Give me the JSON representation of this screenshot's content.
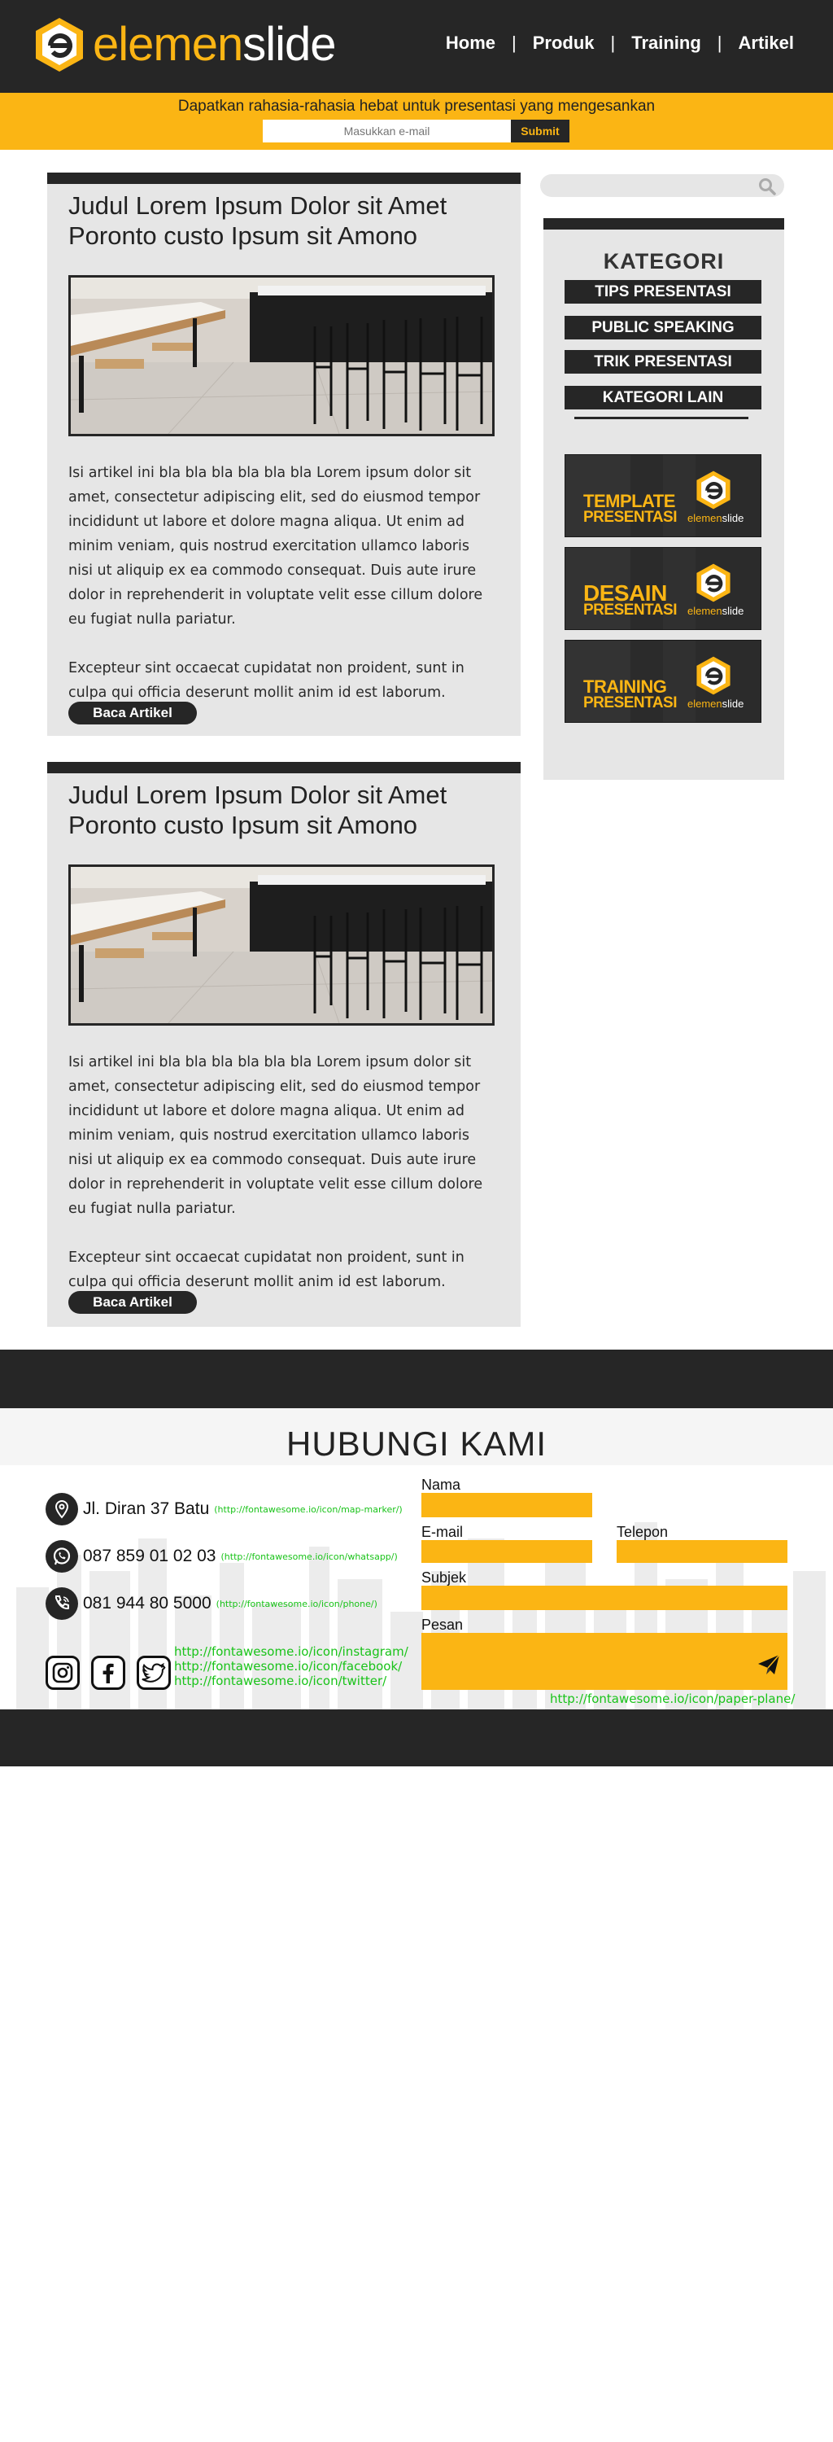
{
  "header": {
    "logo": {
      "part1": "elemen",
      "part2": "slide"
    },
    "nav": [
      "Home",
      "Produk",
      "Training",
      "Artikel"
    ],
    "nav_separator": "|"
  },
  "newsletter": {
    "tagline": "Dapatkan rahasia-rahasia hebat untuk presentasi yang mengesankan",
    "email_placeholder": "Masukkan e-mail",
    "submit_label": "Submit"
  },
  "articles": [
    {
      "title": "Judul Lorem Ipsum Dolor sit Amet Poronto custo Ipsum sit Amono",
      "paragraph1": "Isi artikel ini bla bla bla bla bla bla Lorem ipsum dolor sit amet, consectetur adipiscing elit, sed do eiusmod tempor incididunt ut labore et dolore magna aliqua. Ut enim ad minim veniam, quis nostrud exercitation ullamco laboris nisi ut aliquip ex ea commodo consequat. Duis aute irure dolor in reprehenderit in voluptate velit esse cillum dolore eu fugiat nulla pariatur.",
      "paragraph2": "Excepteur sint occaecat cupidatat non proident, sunt in culpa qui officia deserunt mollit anim id est laborum.",
      "button": "Baca Artikel"
    },
    {
      "title": "Judul Lorem Ipsum Dolor sit Amet Poronto custo Ipsum sit Amono",
      "paragraph1": "Isi artikel ini bla bla bla bla bla bla Lorem ipsum dolor sit amet, consectetur adipiscing elit, sed do eiusmod tempor incididunt ut labore et dolore magna aliqua. Ut enim ad minim veniam, quis nostrud exercitation ullamco laboris nisi ut aliquip ex ea commodo consequat. Duis aute irure dolor in reprehenderit in voluptate velit esse cillum dolore eu fugiat nulla pariatur.",
      "paragraph2": "Excepteur sint occaecat cupidatat non proident, sunt in culpa qui officia deserunt mollit anim id est laborum.",
      "button": "Baca Artikel"
    }
  ],
  "sidebar": {
    "title": "KATEGORI",
    "categories": [
      "TIPS PRESENTASI",
      "PUBLIC SPEAKING",
      "TRIK PRESENTASI",
      "KATEGORI LAIN"
    ],
    "banners": [
      {
        "line1": "TEMPLATE",
        "line2": "PRESENTASI",
        "brand1": "elemen",
        "brand2": "slide"
      },
      {
        "line1": "DESAIN",
        "line2": "PRESENTASI",
        "brand1": "elemen",
        "brand2": "slide"
      },
      {
        "line1": "TRAINING",
        "line2": "PRESENTASI",
        "brand1": "elemen",
        "brand2": "slide"
      }
    ]
  },
  "contact": {
    "heading": "HUBUNGI KAMI",
    "address": "Jl. Diran 37 Batu",
    "address_note": "(http://fontawesome.io/icon/map-marker/)",
    "whatsapp": "087 859 01 02 03",
    "whatsapp_note": "(http://fontawesome.io/icon/whatsapp/)",
    "phone": "081 944 80 5000",
    "phone_note": "(http://fontawesome.io/icon/phone/)",
    "social_links": [
      "http://fontawesome.io/icon/instagram/",
      "http://fontawesome.io/icon/facebook/",
      "http://fontawesome.io/icon/twitter/"
    ],
    "form": {
      "name_label": "Nama",
      "email_label": "E-mail",
      "phone_label": "Telepon",
      "subject_label": "Subjek",
      "message_label": "Pesan",
      "send_note": "http://fontawesome.io/icon/paper-plane/"
    }
  },
  "colors": {
    "accent": "#fbb514",
    "dark": "#262626",
    "panel": "#e6e6e6",
    "note_green": "#19c319"
  }
}
